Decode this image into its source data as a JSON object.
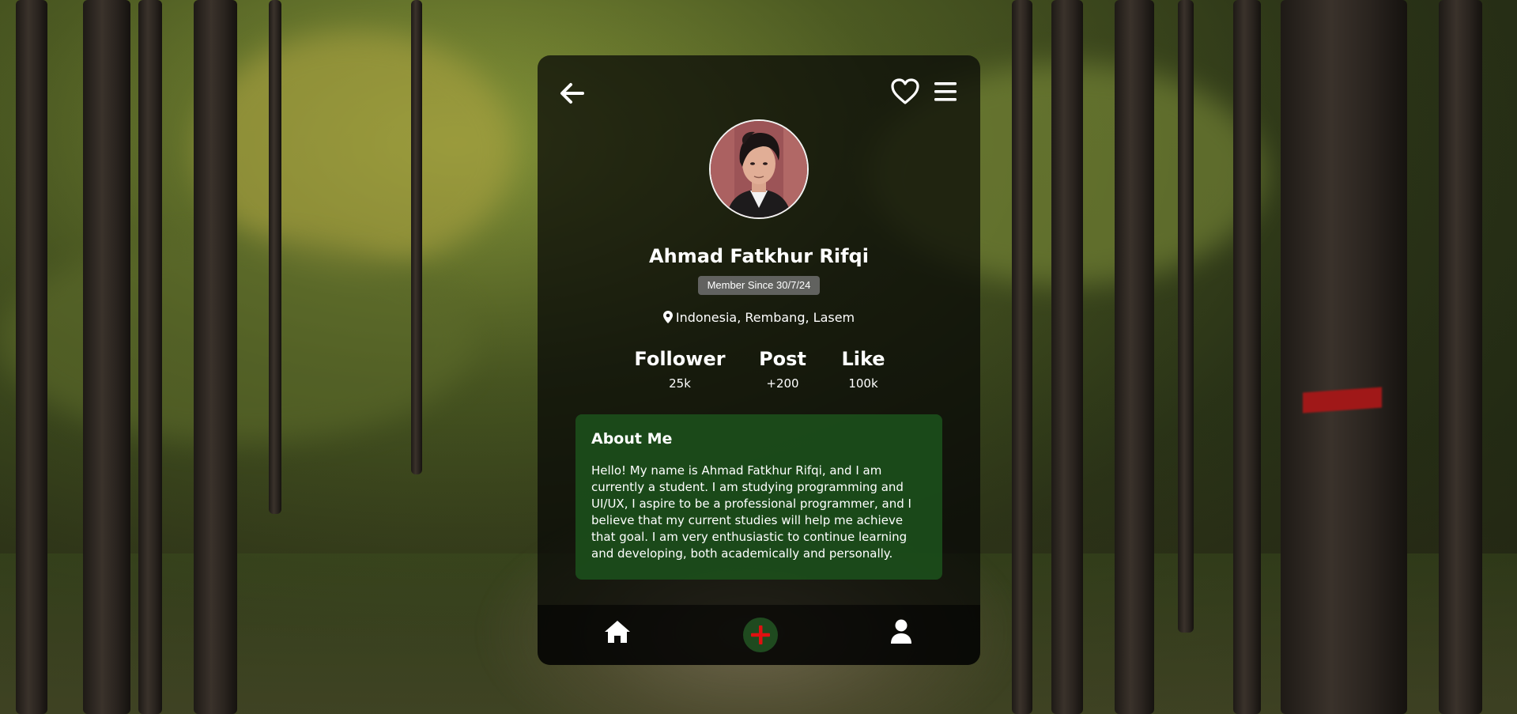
{
  "profile": {
    "name": "Ahmad Fatkhur Rifqi",
    "member_since": "Member Since 30/7/24",
    "location": "Indonesia, Rembang, Lasem"
  },
  "stats": [
    {
      "label": "Follower",
      "value": "25k"
    },
    {
      "label": "Post",
      "value": "+200"
    },
    {
      "label": "Like",
      "value": "100k"
    }
  ],
  "about": {
    "title": "About Me",
    "text": "Hello! My name is Ahmad Fatkhur Rifqi, and I am currently a student. I am studying programming and UI/UX, I aspire to be a professional programmer, and I believe that my current studies will help me achieve that goal. I am very enthusiastic to continue learning and developing, both academically and personally."
  },
  "icons": {
    "top_left": "arrow-left-icon",
    "top_right": [
      "heart-icon",
      "menu-icon"
    ],
    "location": "map-pin-icon",
    "nav": [
      "home-icon",
      "plus-icon",
      "user-icon"
    ]
  },
  "colors": {
    "card_bg": "#050505",
    "about_bg": "#1c521c",
    "add_button_bg": "#1f4a1f",
    "add_icon": "#e01010",
    "badge_bg": "#6e6e6e"
  }
}
